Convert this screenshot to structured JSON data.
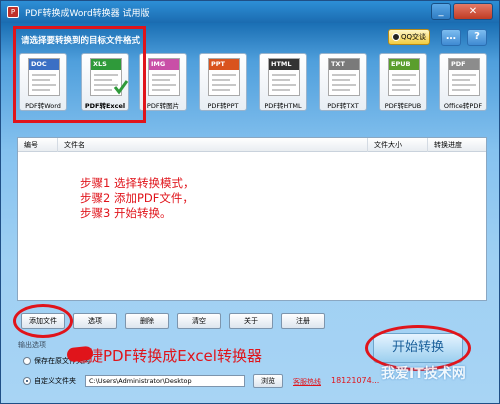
{
  "window": {
    "title": "PDF转换成Word转换器 试用版",
    "min_glyph": "_",
    "close_glyph": "✕",
    "app_icon_glyph": "P"
  },
  "toolbar": {
    "prompt": "请选择要转换到的目标文件格式",
    "qq_label": "QQ交谈",
    "chat_glyph": "…",
    "menu_glyph": "?"
  },
  "formats": [
    {
      "band": "DOC",
      "label": "PDF转Word",
      "color": "#3b6fc4"
    },
    {
      "band": "XLS",
      "label": "PDF转Excel",
      "color": "#2f9a3a",
      "selected": true
    },
    {
      "band": "IMG",
      "label": "PDF转图片",
      "color": "#c94fa7"
    },
    {
      "band": "PPT",
      "label": "PDF转PPT",
      "color": "#d9531e"
    },
    {
      "band": "HTML",
      "label": "PDF转HTML",
      "color": "#333333"
    },
    {
      "band": "TXT",
      "label": "PDF转TXT",
      "color": "#7a7a7a"
    },
    {
      "band": "EPUB",
      "label": "PDF转EPUB",
      "color": "#5a9e2d"
    },
    {
      "band": "PDF",
      "label": "Office转PDF",
      "color": "#8c8c8c"
    }
  ],
  "list": {
    "columns": [
      "编号",
      "文件名",
      "文件大小",
      "转换进度"
    ],
    "steps": [
      "步骤1 选择转换模式，",
      "步骤2 添加PDF文件，",
      "步骤3 开始转换。"
    ]
  },
  "actions": [
    "添加文件",
    "选项",
    "删除",
    "清空",
    "关于",
    "注册"
  ],
  "output": {
    "section_title": "输出选项",
    "option_original": "保存在原文件夹内",
    "option_custom": "自定义文件夹",
    "path_value": "C:\\Users\\Administrator\\Desktop",
    "browse_label": "浏览"
  },
  "banner": "迅捷PDF转换成Excel转换器",
  "start_label": "开始转换",
  "hotline_label": "客服热线",
  "hotline_number": "18121074...",
  "watermark": "我爱IT技术网",
  "colors": {
    "accent_red": "#e0141b",
    "title_blue": "#1b6bb0"
  }
}
